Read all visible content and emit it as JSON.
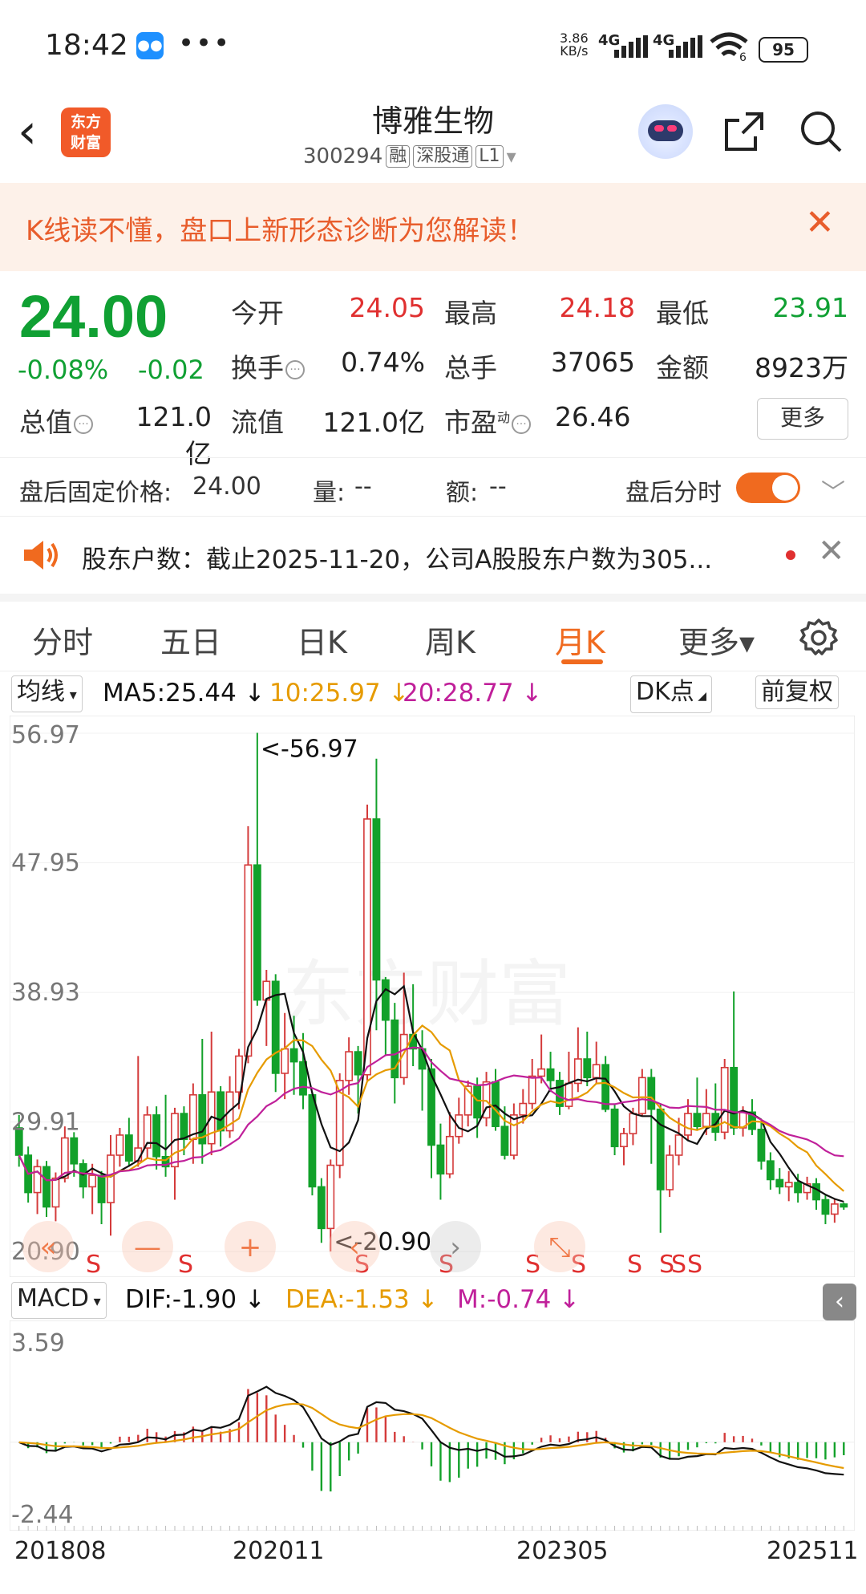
{
  "status_bar": {
    "time": "18:42",
    "dots": "•••",
    "net_speed_top": "3.86",
    "net_speed_bottom": "KB/s",
    "sig1": "4G",
    "sig2": "4G",
    "wifi_sub": "6",
    "battery": "95"
  },
  "header": {
    "back_icon": "chevron-left",
    "logo_text_1": "东方",
    "logo_text_2": "财富",
    "title": "博雅生物",
    "code": "300294",
    "tags": [
      "融",
      "深股通",
      "L1"
    ],
    "dropdown": "▾"
  },
  "banner": {
    "text": "K线读不懂，盘口上新形态诊断为您解读！",
    "close": "✕"
  },
  "quote": {
    "price": "24.00",
    "change_pct": "-0.08%",
    "change": "-0.02",
    "open_label": "今开",
    "open": "24.05",
    "high_label": "最高",
    "high": "24.18",
    "low_label": "最低",
    "low": "23.91",
    "turnover_label": "换手",
    "turnover": "0.74%",
    "volume_label": "总手",
    "volume": "37065",
    "amount_label": "金额",
    "amount": "8923万",
    "mcap_label": "总值",
    "mcap": "121.0亿",
    "float_label": "流值",
    "float": "121.0亿",
    "pe_label": "市盈",
    "pe_sup": "动",
    "pe": "26.46",
    "more": "更多"
  },
  "after_hours": {
    "fixed_label": "盘后固定价格:",
    "fixed_value": "24.00",
    "vol_label": "量:",
    "vol_value": "--",
    "amt_label": "额:",
    "amt_value": "--",
    "intraday_label": "盘后分时",
    "chevron": "﹀"
  },
  "news": {
    "text": "股东户数：截止2025-11-20，公司A股股东户数为305...",
    "close": "✕"
  },
  "tabs": [
    {
      "label": "分时"
    },
    {
      "label": "五日"
    },
    {
      "label": "日K"
    },
    {
      "label": "周K"
    },
    {
      "label": "月K",
      "active": true
    },
    {
      "label": "更多▾"
    }
  ],
  "ma_row": {
    "selector": "均线",
    "ma5": "MA5:25.44",
    "ma5_arrow": "↓",
    "ma10": "10:25.97",
    "ma10_arrow": "↓",
    "ma20": "20:28.77",
    "ma20_arrow": "↓",
    "dk": "DK点",
    "adj": "前复权"
  },
  "macd_row": {
    "selector": "MACD",
    "dif": "DIF:-1.90",
    "dif_arrow": "↓",
    "dea": "DEA:-1.53",
    "dea_arrow": "↓",
    "m": "M:-0.74",
    "m_arrow": "↓"
  },
  "dates": [
    "201808",
    "202011",
    "202305",
    "202511"
  ],
  "colors": {
    "up": "#d43a3a",
    "down": "#12a12a",
    "ma5": "#111111",
    "ma10": "#e69b00",
    "ma20": "#c0209a",
    "accent": "#f06a1f"
  },
  "chart_data": [
    {
      "type": "candlestick",
      "title": "",
      "y_axis_labels": [
        "56.97",
        "47.95",
        "38.93",
        "29.91",
        "20.90"
      ],
      "ylim": [
        20.9,
        56.97
      ],
      "annotations": {
        "max": "<-56.97",
        "min": "<-20.90",
        "signals": [
          "S",
          "S",
          "S",
          "S",
          "S",
          "S",
          "S",
          "S",
          "S",
          "S"
        ]
      },
      "candles": [
        [
          29.5,
          27.6,
          30.4,
          26.8
        ],
        [
          27.6,
          25.0,
          28.2,
          24.3
        ],
        [
          25.0,
          26.8,
          27.3,
          23.5
        ],
        [
          26.8,
          24.0,
          27.2,
          23.3
        ],
        [
          24.0,
          26.0,
          26.4,
          23.0
        ],
        [
          26.0,
          28.8,
          29.6,
          25.7
        ],
        [
          28.8,
          27.0,
          29.2,
          26.1
        ],
        [
          27.0,
          25.4,
          27.3,
          24.6
        ],
        [
          25.4,
          26.2,
          27.0,
          23.5
        ],
        [
          26.2,
          24.3,
          26.5,
          22.8
        ],
        [
          24.3,
          27.6,
          29.0,
          22.0
        ],
        [
          27.6,
          29.0,
          29.5,
          26.8
        ],
        [
          29.0,
          27.2,
          30.2,
          26.8
        ],
        [
          27.2,
          28.1,
          34.5,
          26.8
        ],
        [
          28.1,
          30.4,
          31.0,
          27.4
        ],
        [
          30.4,
          27.5,
          31.0,
          26.6
        ],
        [
          27.5,
          26.8,
          31.8,
          26.1
        ],
        [
          26.8,
          30.5,
          30.9,
          24.5
        ],
        [
          30.5,
          28.7,
          31.0,
          27.6
        ],
        [
          28.7,
          31.8,
          32.6,
          27.0
        ],
        [
          31.8,
          28.4,
          35.7,
          27.0
        ],
        [
          28.4,
          32.0,
          36.2,
          27.6
        ],
        [
          32.0,
          29.3,
          32.4,
          28.2
        ],
        [
          29.3,
          32.0,
          33.1,
          28.8
        ],
        [
          32.0,
          34.5,
          35.0,
          30.8
        ],
        [
          34.5,
          47.8,
          50.5,
          34.0
        ],
        [
          47.8,
          38.4,
          57.0,
          38.0
        ],
        [
          38.4,
          39.7,
          40.5,
          35.2
        ],
        [
          39.7,
          33.3,
          40.2,
          32.0
        ],
        [
          33.3,
          35.0,
          37.5,
          31.5
        ],
        [
          35.0,
          34.1,
          37.3,
          31.8
        ],
        [
          34.1,
          31.8,
          36.1,
          30.8
        ],
        [
          31.8,
          25.4,
          32.0,
          24.8
        ],
        [
          25.4,
          22.5,
          26.0,
          21.5
        ],
        [
          22.5,
          26.9,
          27.3,
          20.9
        ],
        [
          26.9,
          32.8,
          33.3,
          26.0
        ],
        [
          32.8,
          34.8,
          35.8,
          31.8
        ],
        [
          34.8,
          33.2,
          35.2,
          30.5
        ],
        [
          33.2,
          51.0,
          52.0,
          32.8
        ],
        [
          51.0,
          39.8,
          55.2,
          36.3
        ],
        [
          39.8,
          37.0,
          40.0,
          34.5
        ],
        [
          37.0,
          33.0,
          38.2,
          31.2
        ],
        [
          33.0,
          36.0,
          40.3,
          32.5
        ],
        [
          36.0,
          35.0,
          39.5,
          33.8
        ],
        [
          35.0,
          33.6,
          36.3,
          30.7
        ],
        [
          33.6,
          28.3,
          34.3,
          26.0
        ],
        [
          28.3,
          26.3,
          29.8,
          24.5
        ],
        [
          26.3,
          28.9,
          30.6,
          26.0
        ],
        [
          28.9,
          30.4,
          31.6,
          28.4
        ],
        [
          30.4,
          32.4,
          32.8,
          29.6
        ],
        [
          32.4,
          30.2,
          33.0,
          28.8
        ],
        [
          30.2,
          32.7,
          33.4,
          29.6
        ],
        [
          32.7,
          29.6,
          33.6,
          29.3
        ],
        [
          29.6,
          27.6,
          31.0,
          27.3
        ],
        [
          27.6,
          30.4,
          31.2,
          27.3
        ],
        [
          30.4,
          31.2,
          32.2,
          29.8
        ],
        [
          31.2,
          33.1,
          34.3,
          30.8
        ],
        [
          33.1,
          33.6,
          36.0,
          32.6
        ],
        [
          33.6,
          32.8,
          34.8,
          32.0
        ],
        [
          32.8,
          31.0,
          33.4,
          30.4
        ],
        [
          31.0,
          32.6,
          34.8,
          30.8
        ],
        [
          32.6,
          34.3,
          36.5,
          32.0
        ],
        [
          34.3,
          33.0,
          36.2,
          32.4
        ],
        [
          33.0,
          33.9,
          35.5,
          32.6
        ],
        [
          33.9,
          30.8,
          34.5,
          30.6
        ],
        [
          30.8,
          28.2,
          31.2,
          27.6
        ],
        [
          28.2,
          29.1,
          29.5,
          26.9
        ],
        [
          29.1,
          30.5,
          30.9,
          28.3
        ],
        [
          30.5,
          33.0,
          33.6,
          30.3
        ],
        [
          33.0,
          30.8,
          33.6,
          27.0
        ],
        [
          30.8,
          25.2,
          31.2,
          22.2
        ],
        [
          25.2,
          27.6,
          28.3,
          24.7
        ],
        [
          27.6,
          29.0,
          30.2,
          26.9
        ],
        [
          29.0,
          30.5,
          31.5,
          28.6
        ],
        [
          30.5,
          29.6,
          33.0,
          29.3
        ],
        [
          29.6,
          30.5,
          32.2,
          29.0
        ],
        [
          30.5,
          29.2,
          32.6,
          28.6
        ],
        [
          29.2,
          33.7,
          34.3,
          28.7
        ],
        [
          33.7,
          29.5,
          39.0,
          29.0
        ],
        [
          29.5,
          30.6,
          31.0,
          28.9
        ],
        [
          30.6,
          29.4,
          31.5,
          29.0
        ],
        [
          29.4,
          27.2,
          29.9,
          26.6
        ],
        [
          27.2,
          25.9,
          27.8,
          25.2
        ],
        [
          25.9,
          25.4,
          26.7,
          24.9
        ],
        [
          25.4,
          25.7,
          26.5,
          24.4
        ],
        [
          25.7,
          25.0,
          26.3,
          24.3
        ],
        [
          25.0,
          25.6,
          26.1,
          24.5
        ],
        [
          25.6,
          24.5,
          26.0,
          23.8
        ],
        [
          24.5,
          23.5,
          24.8,
          22.8
        ],
        [
          23.5,
          24.2,
          24.6,
          22.9
        ],
        [
          24.2,
          24.0,
          24.3,
          23.8
        ]
      ],
      "ma_lines": [
        "MA5",
        "MA10",
        "MA20"
      ]
    },
    {
      "type": "macd",
      "title": "",
      "y_axis_labels": [
        "3.59",
        "-2.44"
      ],
      "ylim": [
        -2.44,
        3.59
      ],
      "series": [
        {
          "name": "DIF"
        },
        {
          "name": "DEA"
        },
        {
          "name": "M"
        }
      ]
    }
  ]
}
